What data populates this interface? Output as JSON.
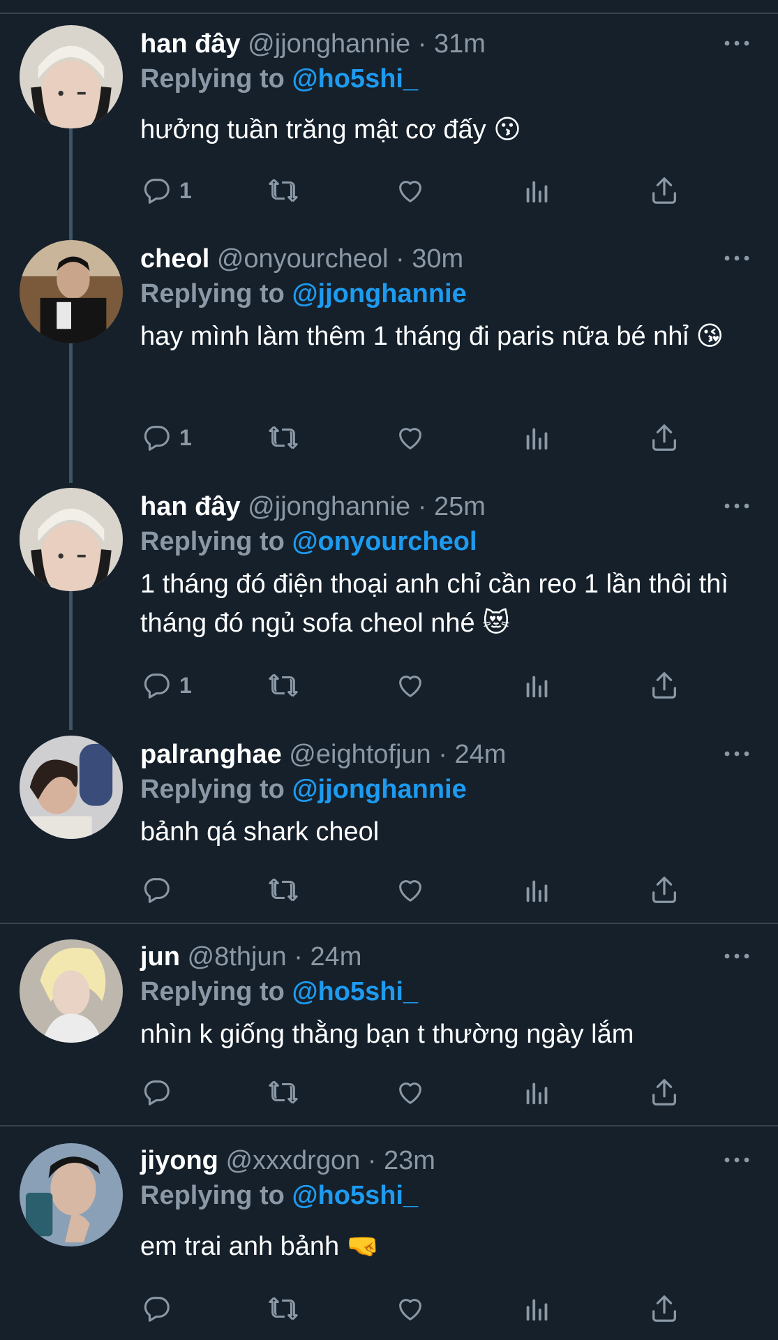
{
  "colors": {
    "background": "#15202b",
    "accent": "#1d9bf0",
    "muted": "#8b98a5",
    "separator": "#38444d",
    "thread_line": "#3d5466"
  },
  "icons": [
    "reply-icon",
    "retweet-icon",
    "like-icon",
    "analytics-icon",
    "share-icon",
    "more-icon"
  ],
  "tweets": [
    {
      "name": "han đây",
      "handle": "@jjonghannie",
      "time": "31m",
      "replying_prefix": "Replying to ",
      "replying_to": "@ho5shi_",
      "text": "hưởng tuần trăng mật cơ đấy 😗",
      "reply_count": "1"
    },
    {
      "name": "cheol",
      "handle": "@onyourcheol",
      "time": "30m",
      "replying_prefix": "Replying to ",
      "replying_to": "@jjonghannie",
      "text": "hay mình làm thêm 1 tháng đi paris nữa bé nhỉ 😘",
      "reply_count": "1"
    },
    {
      "name": "han đây",
      "handle": "@jjonghannie",
      "time": "25m",
      "replying_prefix": "Replying to ",
      "replying_to": "@onyourcheol",
      "text": "1 tháng đó điện thoại anh chỉ cần reo 1 lần thôi thì tháng đó ngủ sofa cheol nhé 😻",
      "reply_count": "1"
    },
    {
      "name": "palranghae",
      "handle": "@eightofjun",
      "time": "24m",
      "replying_prefix": "Replying to ",
      "replying_to": "@jjonghannie",
      "text": "bảnh qá shark cheol",
      "reply_count": ""
    },
    {
      "name": "jun",
      "handle": "@8thjun",
      "time": "24m",
      "replying_prefix": "Replying to ",
      "replying_to": "@ho5shi_",
      "text": "nhìn k giống thằng bạn t thường ngày lắm",
      "reply_count": ""
    },
    {
      "name": "jiyong",
      "handle": "@xxxdrgon",
      "time": "23m",
      "replying_prefix": "Replying to ",
      "replying_to": "@ho5shi_",
      "text": "em trai anh bảnh 🤜",
      "reply_count": ""
    }
  ]
}
